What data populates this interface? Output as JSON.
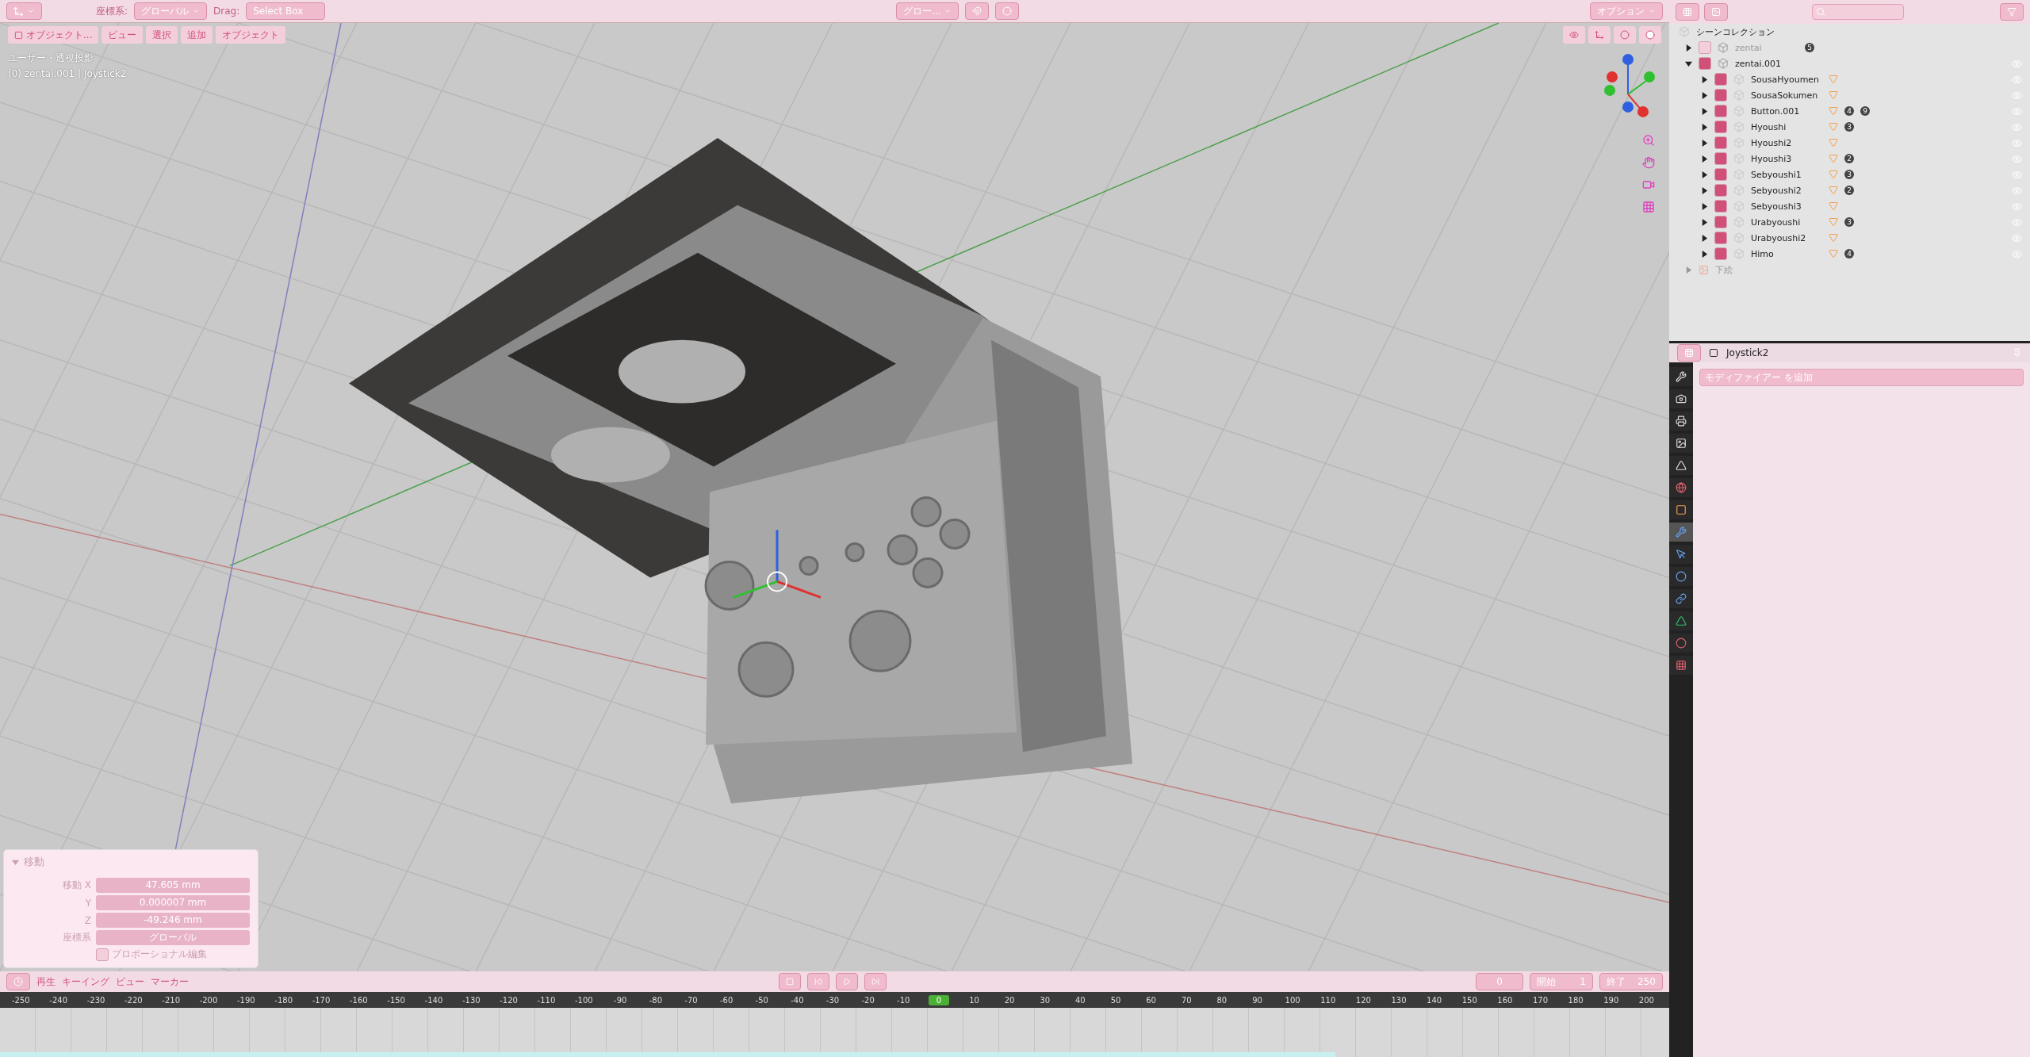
{
  "header": {
    "coord_label": "座標系:",
    "coord_value": "グローバル",
    "drag_label": "Drag:",
    "drag_value": "Select Box",
    "pivot_value": "グロー...",
    "options": "オプション"
  },
  "viewport_menu": {
    "mode": "オブジェクト...",
    "menus": [
      "ビュー",
      "選択",
      "追加",
      "オブジェクト"
    ]
  },
  "viewport_info": [
    "ユーザー・透視投影",
    "(0) zentai.001 | Joystick2"
  ],
  "operator_panel": {
    "title": "移動",
    "expanded": true,
    "fields": [
      {
        "label": "移動 X",
        "value": "47.605 mm"
      },
      {
        "label": "Y",
        "value": "0.000007 mm"
      },
      {
        "label": "Z",
        "value": "-49.246 mm"
      }
    ],
    "coord_label": "座標系",
    "coord_value": "グローバル",
    "proportional": {
      "label": "プロポーショナル編集",
      "checked": false
    }
  },
  "outliner": {
    "root": "シーンコレクション",
    "collections": [
      {
        "name": "zentai",
        "checked": false,
        "expanded": false,
        "badge": "5"
      },
      {
        "name": "zentai.001",
        "checked": true,
        "expanded": true,
        "children": [
          {
            "name": "SousaHyoumen",
            "checked": true
          },
          {
            "name": "SousaSokumen",
            "checked": true
          },
          {
            "name": "Button.001",
            "checked": true,
            "badge": "4",
            "badge2": "9"
          },
          {
            "name": "Hyoushi",
            "checked": true,
            "badge": "3"
          },
          {
            "name": "Hyoushi2",
            "checked": true
          },
          {
            "name": "Hyoushi3",
            "checked": true,
            "badge": "2"
          },
          {
            "name": "Sebyoushi1",
            "checked": true,
            "badge": "3"
          },
          {
            "name": "Sebyoushi2",
            "checked": true,
            "badge": "2"
          },
          {
            "name": "Sebyoushi3",
            "checked": true
          },
          {
            "name": "Urabyoushi",
            "checked": true,
            "badge": "3"
          },
          {
            "name": "Urabyoushi2",
            "checked": true
          },
          {
            "name": "Himo",
            "checked": true,
            "badge": "4"
          }
        ]
      }
    ],
    "extra": "下絵"
  },
  "properties": {
    "object": "Joystick2",
    "add_modifier": "モディファイアー を追加",
    "tabs": [
      {
        "kind": "tool",
        "selected": false
      },
      {
        "kind": "render",
        "selected": false
      },
      {
        "kind": "output",
        "selected": false
      },
      {
        "kind": "view-layer",
        "selected": false
      },
      {
        "kind": "scene",
        "selected": false
      },
      {
        "kind": "world",
        "selected": false
      },
      {
        "kind": "object",
        "selected": false
      },
      {
        "kind": "modifier",
        "selected": true
      },
      {
        "kind": "particles",
        "selected": false
      },
      {
        "kind": "physics",
        "selected": false
      },
      {
        "kind": "constraints",
        "selected": false
      },
      {
        "kind": "data",
        "selected": false
      },
      {
        "kind": "material",
        "selected": false
      },
      {
        "kind": "texture",
        "selected": false
      }
    ]
  },
  "timeline": {
    "menus": [
      "再生",
      "キーイング",
      "ビュー",
      "マーカー"
    ],
    "frame": "0",
    "start_label": "開始",
    "start": "1",
    "end_label": "終了",
    "end": "250",
    "ticks": [
      {
        "label": "-250",
        "selected": false
      },
      {
        "label": "-240",
        "selected": false
      },
      {
        "label": "-230",
        "selected": false
      },
      {
        "label": "-220",
        "selected": false
      },
      {
        "label": "-210",
        "selected": false
      },
      {
        "label": "-200",
        "selected": false
      },
      {
        "label": "-190",
        "selected": false
      },
      {
        "label": "-180",
        "selected": false
      },
      {
        "label": "-170",
        "selected": false
      },
      {
        "label": "-160",
        "selected": false
      },
      {
        "label": "-150",
        "selected": false
      },
      {
        "label": "-140",
        "selected": false
      },
      {
        "label": "-130",
        "selected": false
      },
      {
        "label": "-120",
        "selected": false
      },
      {
        "label": "-110",
        "selected": false
      },
      {
        "label": "-100",
        "selected": false
      },
      {
        "label": "-90",
        "selected": false
      },
      {
        "label": "-80",
        "selected": false
      },
      {
        "label": "-70",
        "selected": false
      },
      {
        "label": "-60",
        "selected": false
      },
      {
        "label": "-50",
        "selected": false
      },
      {
        "label": "-40",
        "selected": false
      },
      {
        "label": "-30",
        "selected": false
      },
      {
        "label": "-20",
        "selected": false
      },
      {
        "label": "-10",
        "selected": false
      },
      {
        "label": "0",
        "selected": true
      },
      {
        "label": "10",
        "selected": false
      },
      {
        "label": "20",
        "selected": false
      },
      {
        "label": "30",
        "selected": false
      },
      {
        "label": "40",
        "selected": false
      },
      {
        "label": "50",
        "selected": false
      },
      {
        "label": "60",
        "selected": false
      },
      {
        "label": "70",
        "selected": false
      },
      {
        "label": "80",
        "selected": false
      },
      {
        "label": "90",
        "selected": false
      },
      {
        "label": "100",
        "selected": false
      },
      {
        "label": "110",
        "selected": false
      },
      {
        "label": "120",
        "selected": false
      },
      {
        "label": "130",
        "selected": false
      },
      {
        "label": "140",
        "selected": false
      },
      {
        "label": "150",
        "selected": false
      },
      {
        "label": "160",
        "selected": false
      },
      {
        "label": "170",
        "selected": false
      },
      {
        "label": "180",
        "selected": false
      },
      {
        "label": "190",
        "selected": false
      },
      {
        "label": "200",
        "selected": false
      }
    ]
  }
}
